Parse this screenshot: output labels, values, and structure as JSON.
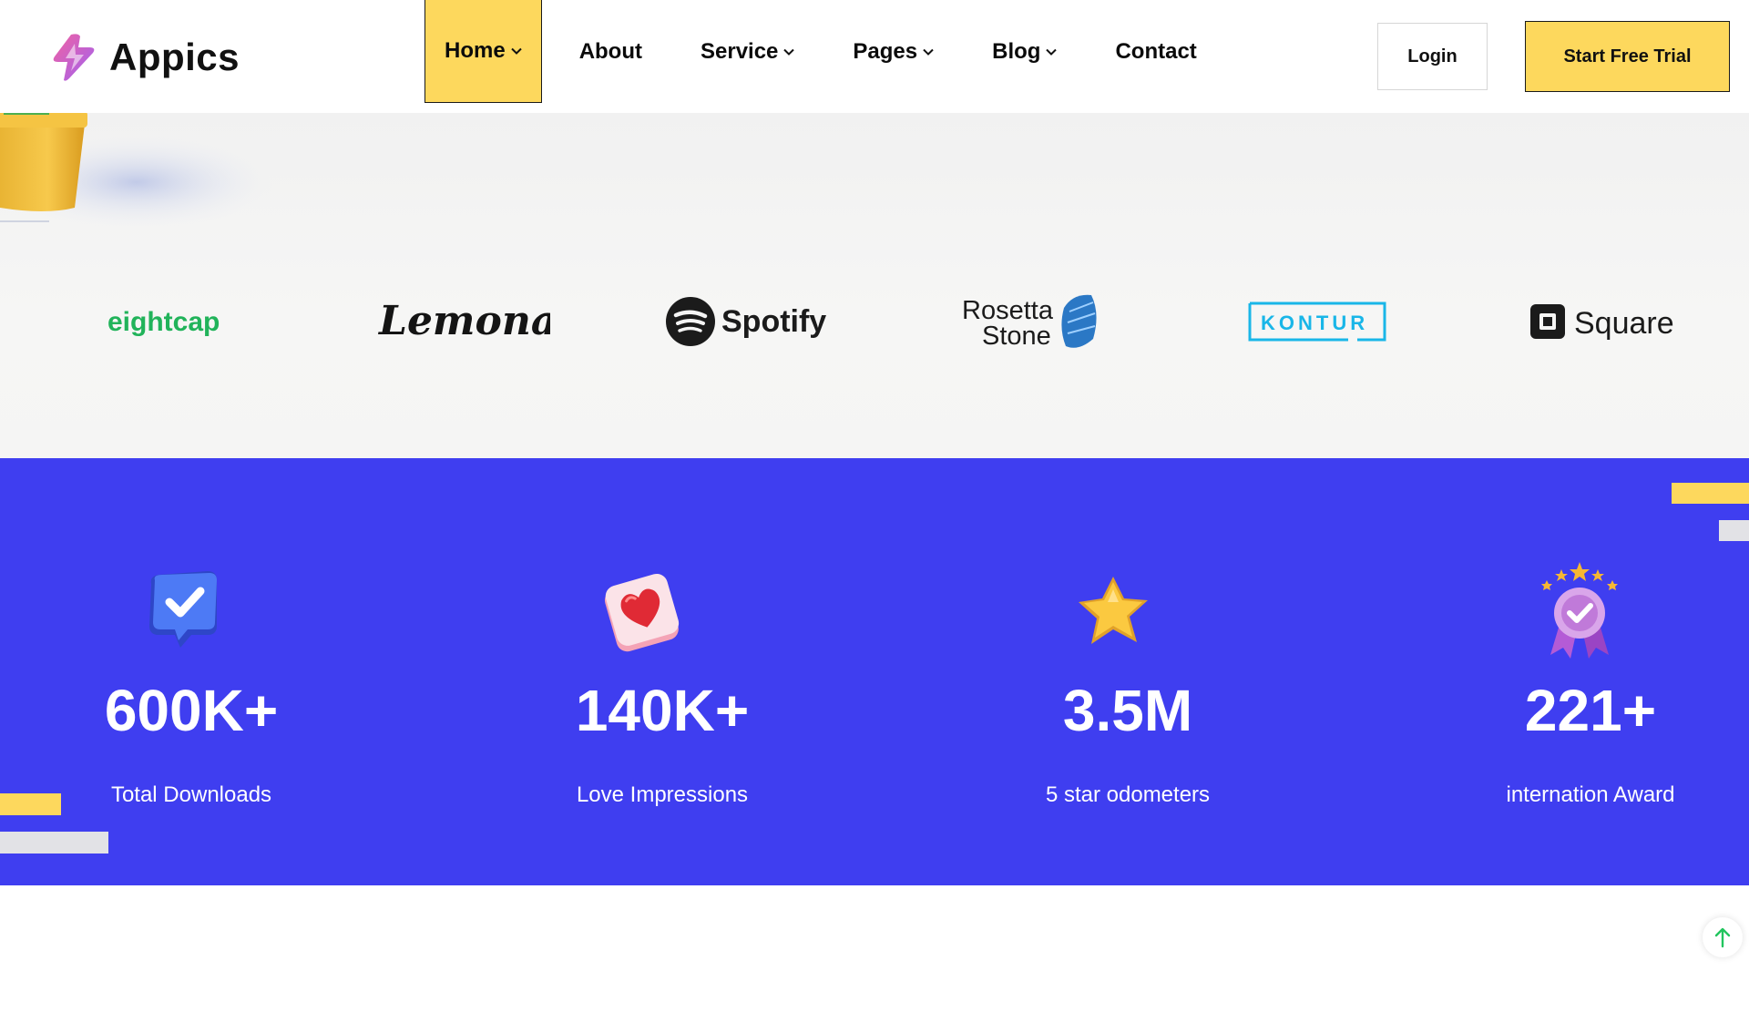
{
  "header": {
    "brand_name": "Appics",
    "nav": [
      {
        "label": "Home",
        "has_dropdown": true,
        "active": true
      },
      {
        "label": "About",
        "has_dropdown": false
      },
      {
        "label": "Service",
        "has_dropdown": true
      },
      {
        "label": "Pages",
        "has_dropdown": true
      },
      {
        "label": "Blog",
        "has_dropdown": true
      },
      {
        "label": "Contact",
        "has_dropdown": false
      }
    ],
    "login_label": "Login",
    "trial_label": "Start Free Trial"
  },
  "partners": [
    {
      "name": "eightcap",
      "icon": "eightcap-logo"
    },
    {
      "name": "Lemonade",
      "icon": "lemonade-logo"
    },
    {
      "name": "Spotify",
      "icon": "spotify-logo"
    },
    {
      "name": "Rosetta Stone",
      "icon": "rosetta-stone-logo"
    },
    {
      "name": "KONTUR",
      "icon": "kontur-logo"
    },
    {
      "name": "Square",
      "icon": "square-logo"
    }
  ],
  "stats": [
    {
      "value": "600K+",
      "label": "Total Downloads",
      "icon": "check-badge-icon"
    },
    {
      "value": "140K+",
      "label": "Love Impressions",
      "icon": "heart-card-icon"
    },
    {
      "value": "3.5M",
      "label": "5 star odometers",
      "icon": "star-icon"
    },
    {
      "value": "221+",
      "label": "internation Award",
      "icon": "award-medal-icon"
    }
  ],
  "colors": {
    "accent_yellow": "#fdd85d",
    "stats_blue": "#3f3ef0",
    "eightcap_green": "#21b35a",
    "kontur_cyan": "#19b6e8",
    "back_to_top_green": "#22c55e"
  }
}
